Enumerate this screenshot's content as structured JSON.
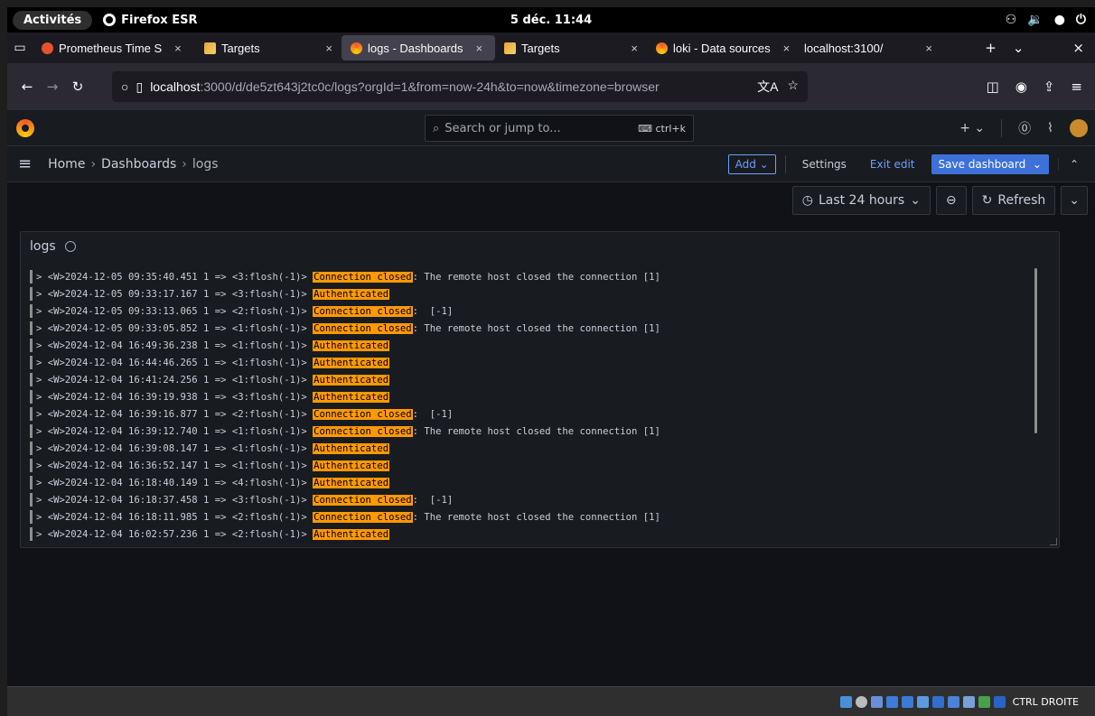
{
  "gnome": {
    "activities": "Activités",
    "app_name": "Firefox ESR",
    "clock": "5 déc. 11:44"
  },
  "tabs": [
    {
      "label": "Prometheus Time S",
      "favicon": "prometheus-icon"
    },
    {
      "label": "Targets",
      "favicon": "targets-icon"
    },
    {
      "label": "logs - Dashboards",
      "favicon": "grafana-icon",
      "active": true
    },
    {
      "label": "Targets",
      "favicon": "targets-icon"
    },
    {
      "label": "loki - Data sources",
      "favicon": "grafana-icon"
    },
    {
      "label": "localhost:3100/",
      "favicon": ""
    }
  ],
  "url": {
    "host": "localhost",
    "rest": ":3000/d/de5zt643j2tc0c/logs?orgId=1&from=now-24h&to=now&timezone=browser"
  },
  "grafana": {
    "search_placeholder": "Search or jump to...",
    "search_shortcut": "ctrl+k",
    "breadcrumb": [
      "Home",
      "Dashboards",
      "logs"
    ],
    "toolbar": {
      "add": "Add",
      "settings": "Settings",
      "exit_edit": "Exit edit",
      "save_dashboard": "Save dashboard"
    },
    "time_range": "Last 24 hours",
    "refresh": "Refresh",
    "panel_title": "logs"
  },
  "logs": [
    {
      "prefix": "> <W>2024-12-05 09:35:40.451 1 => <3:flosh(-1)> ",
      "highlight": "Connection closed",
      "suffix": ": The remote host closed the connection [1]"
    },
    {
      "prefix": "> <W>2024-12-05 09:33:17.167 1 => <3:flosh(-1)> ",
      "highlight": "Authenticated",
      "suffix": ""
    },
    {
      "prefix": "> <W>2024-12-05 09:33:13.065 1 => <2:flosh(-1)> ",
      "highlight": "Connection closed",
      "suffix": ":  [-1]"
    },
    {
      "prefix": "> <W>2024-12-05 09:33:05.852 1 => <1:flosh(-1)> ",
      "highlight": "Connection closed",
      "suffix": ": The remote host closed the connection [1]"
    },
    {
      "prefix": "> <W>2024-12-04 16:49:36.238 1 => <1:flosh(-1)> ",
      "highlight": "Authenticated",
      "suffix": ""
    },
    {
      "prefix": "> <W>2024-12-04 16:44:46.265 1 => <1:flosh(-1)> ",
      "highlight": "Authenticated",
      "suffix": ""
    },
    {
      "prefix": "> <W>2024-12-04 16:41:24.256 1 => <1:flosh(-1)> ",
      "highlight": "Authenticated",
      "suffix": ""
    },
    {
      "prefix": "> <W>2024-12-04 16:39:19.938 1 => <3:flosh(-1)> ",
      "highlight": "Authenticated",
      "suffix": ""
    },
    {
      "prefix": "> <W>2024-12-04 16:39:16.877 1 => <2:flosh(-1)> ",
      "highlight": "Connection closed",
      "suffix": ":  [-1]"
    },
    {
      "prefix": "> <W>2024-12-04 16:39:12.740 1 => <1:flosh(-1)> ",
      "highlight": "Connection closed",
      "suffix": ": The remote host closed the connection [1]"
    },
    {
      "prefix": "> <W>2024-12-04 16:39:08.147 1 => <1:flosh(-1)> ",
      "highlight": "Authenticated",
      "suffix": ""
    },
    {
      "prefix": "> <W>2024-12-04 16:36:52.147 1 => <1:flosh(-1)> ",
      "highlight": "Authenticated",
      "suffix": ""
    },
    {
      "prefix": "> <W>2024-12-04 16:18:40.149 1 => <4:flosh(-1)> ",
      "highlight": "Authenticated",
      "suffix": ""
    },
    {
      "prefix": "> <W>2024-12-04 16:18:37.458 1 => <3:flosh(-1)> ",
      "highlight": "Connection closed",
      "suffix": ":  [-1]"
    },
    {
      "prefix": "> <W>2024-12-04 16:18:11.985 1 => <2:flosh(-1)> ",
      "highlight": "Connection closed",
      "suffix": ": The remote host closed the connection [1]"
    },
    {
      "prefix": "> <W>2024-12-04 16:02:57.236 1 => <2:flosh(-1)> ",
      "highlight": "Authenticated",
      "suffix": ""
    }
  ],
  "vm_status": "CTRL DROITE",
  "colors": {
    "highlight": "#ff9900",
    "primary": "#3d71d9"
  }
}
